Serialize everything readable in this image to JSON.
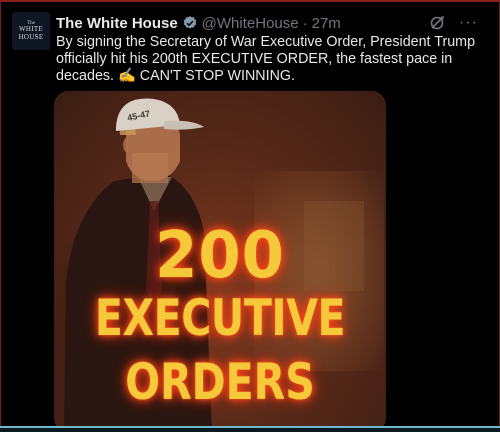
{
  "avatar": {
    "line1": "The",
    "line2": "WHITE",
    "line3": "HOUSE"
  },
  "tweet": {
    "name": "The White House",
    "handle": "@WhiteHouse",
    "separator": "·",
    "time": "27m",
    "icons": [
      "verified-badge-icon",
      "grok-icon",
      "more-options-icon"
    ],
    "more_label": "···",
    "text": "By signing the Secretary of War Executive Order, President Trump officially hit his 200th EXECUTIVE ORDER, the fastest pace in decades. ✍️ CAN'T STOP WINNING."
  },
  "media": {
    "overlay_line1": "200",
    "overlay_line2": "EXECUTIVE",
    "overlay_line3": "ORDERS",
    "cap_text": "45-47"
  },
  "colors": {
    "background": "#000000",
    "text": "#e7e9ea",
    "muted": "#71767b",
    "verified": "#829aab",
    "overlay_text": "#f6c93b",
    "overlay_glow": "#ff3a10"
  }
}
